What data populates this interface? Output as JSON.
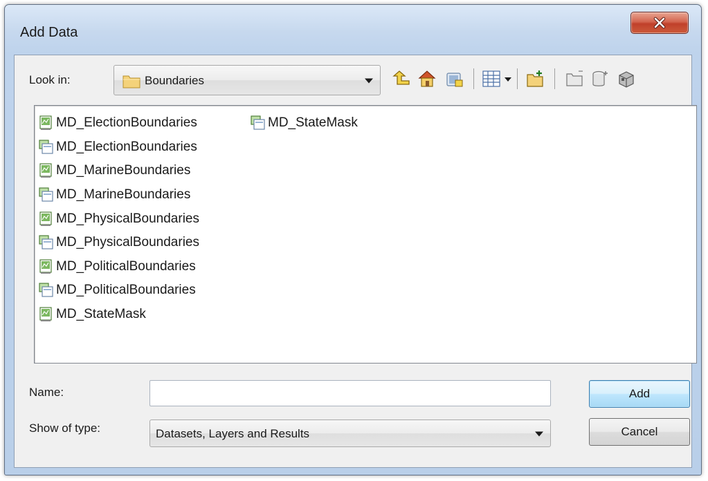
{
  "window": {
    "title": "Add Data"
  },
  "look_in": {
    "label": "Look in:",
    "value": "Boundaries"
  },
  "toolbar": {
    "icons": [
      "up-one-level-icon",
      "home-icon",
      "connect-folder-icon",
      "view-options-icon",
      "new-folder-icon",
      "new-file-geodatabase-icon",
      "new-personal-geodatabase-icon",
      "new-shapefile-icon"
    ]
  },
  "files": {
    "column1": [
      {
        "name": "MD_ElectionBoundaries",
        "icon": "map-document-icon"
      },
      {
        "name": "MD_ElectionBoundaries",
        "icon": "layer-file-icon"
      },
      {
        "name": "MD_MarineBoundaries",
        "icon": "map-document-icon"
      },
      {
        "name": "MD_MarineBoundaries",
        "icon": "layer-file-icon"
      },
      {
        "name": "MD_PhysicalBoundaries",
        "icon": "map-document-icon"
      },
      {
        "name": "MD_PhysicalBoundaries",
        "icon": "layer-file-icon"
      },
      {
        "name": "MD_PoliticalBoundaries",
        "icon": "map-document-icon"
      },
      {
        "name": "MD_PoliticalBoundaries",
        "icon": "layer-file-icon"
      },
      {
        "name": "MD_StateMask",
        "icon": "map-document-icon"
      }
    ],
    "column2": [
      {
        "name": "MD_StateMask",
        "icon": "layer-file-icon"
      }
    ]
  },
  "name_field": {
    "label": "Name:",
    "value": ""
  },
  "type_field": {
    "label": "Show of type:",
    "value": "Datasets, Layers and Results"
  },
  "buttons": {
    "add": "Add",
    "cancel": "Cancel"
  },
  "colors": {
    "title_bar": "#c6d8ee",
    "close_button": "#c7452e",
    "default_button": "#bee6fd",
    "folder": "#f4d27a"
  }
}
